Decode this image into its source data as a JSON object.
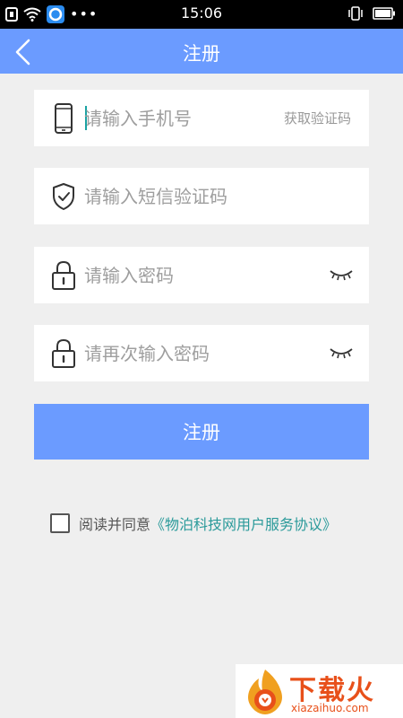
{
  "status_bar": {
    "time": "15:06"
  },
  "nav": {
    "title": "注册"
  },
  "form": {
    "phone_placeholder": "请输入手机号",
    "get_code_label": "获取验证码",
    "sms_code_placeholder": "请输入短信验证码",
    "password_placeholder": "请输入密码",
    "confirm_password_placeholder": "请再次输入密码",
    "submit_label": "注册"
  },
  "agreement": {
    "prefix": "阅读并同意",
    "link": "《物泊科技网用户服务协议》",
    "checked": false
  },
  "watermark": {
    "title": "下载火",
    "subtitle": "xiazaihuo.com"
  },
  "colors": {
    "accent": "#6b9bff",
    "link": "#2a9a9a",
    "background": "#efefef",
    "watermark": "#e8501a"
  },
  "icons": [
    "back-arrow",
    "phone",
    "shield-check",
    "lock",
    "eye-closed"
  ]
}
